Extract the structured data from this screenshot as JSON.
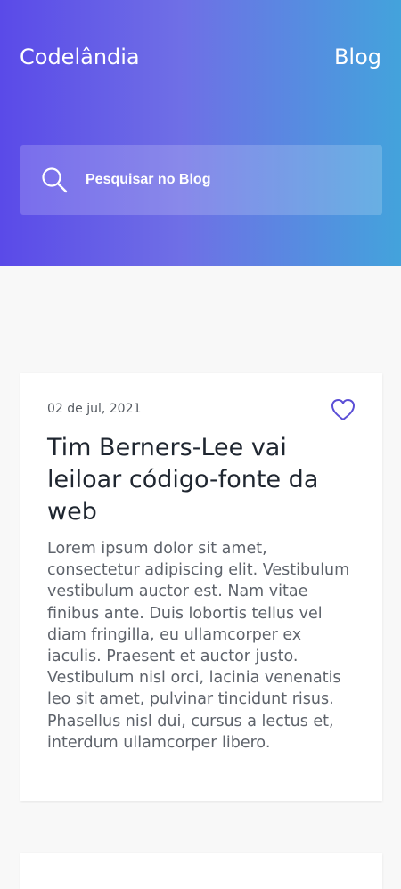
{
  "header": {
    "brand": "Codelândia",
    "nav_link": "Blog"
  },
  "search": {
    "icon": "search-icon",
    "placeholder": "Pesquisar no Blog",
    "value": ""
  },
  "posts": [
    {
      "date": "02 de jul, 2021",
      "favorite_icon": "heart-outline-icon",
      "title": "Tim Berners-Lee vai leiloar código-fonte da web",
      "excerpt": "Lorem ipsum dolor sit amet, consectetur adipiscing elit. Vestibulum vestibulum auctor est. Nam vitae finibus ante. Duis lobortis tellus vel diam fringilla, eu ullamcorper ex iaculis. Praesent et auctor justo. Vestibulum nisl orci, lacinia venenatis leo sit amet, pulvinar tincidunt risus. Phasellus nisl dui, cursus a lectus et, interdum ullamcorper libero."
    }
  ],
  "colors": {
    "gradient_start": "#5a4ae8",
    "gradient_end": "#43a3dc",
    "accent": "#5b4fd6",
    "page_background": "#f8f8f8",
    "card_background": "#ffffff"
  }
}
